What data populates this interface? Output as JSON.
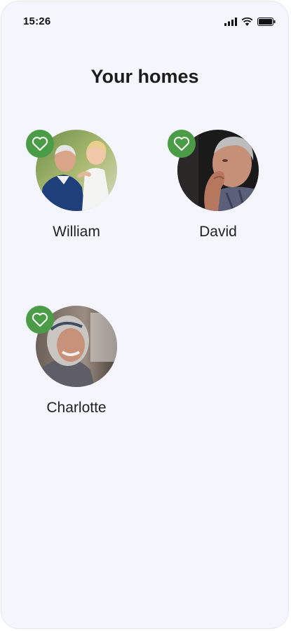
{
  "status_bar": {
    "time": "15:26",
    "icons": [
      "cellular-signal-icon",
      "wifi-icon",
      "battery-icon"
    ]
  },
  "page": {
    "title": "Your homes"
  },
  "homes": [
    {
      "name": "William",
      "favorite": true,
      "photo": "elderly man holding toddler"
    },
    {
      "name": "David",
      "favorite": true,
      "photo": "elderly man with hand on face"
    },
    {
      "name": "Charlotte",
      "favorite": true,
      "photo": "elderly woman smiling"
    }
  ],
  "colors": {
    "background": "#f4f5fd",
    "favorite_badge": "#4a9c47",
    "text": "#1c1c1c"
  }
}
